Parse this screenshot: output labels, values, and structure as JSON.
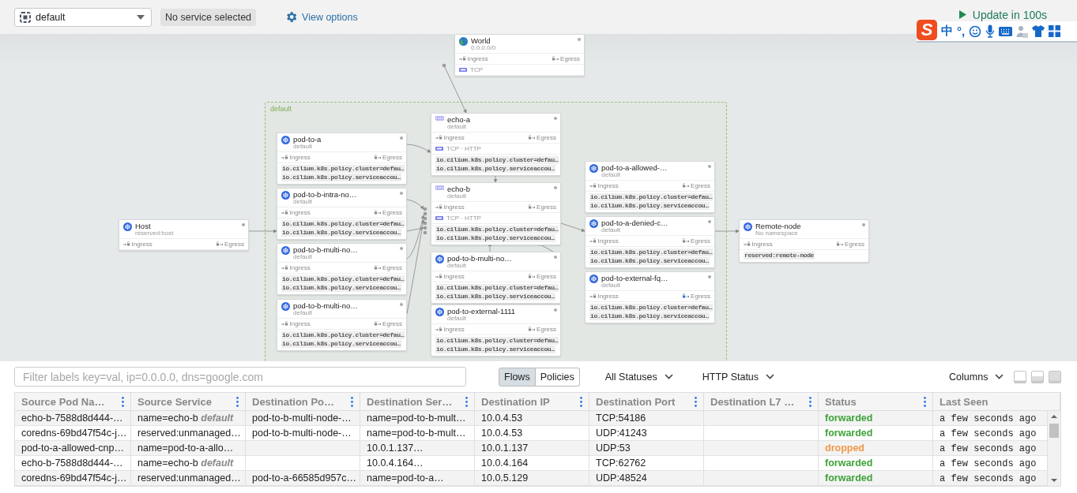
{
  "top_bar": {
    "namespace_select": {
      "value": "default"
    },
    "service_chip": "No service selected",
    "view_options": "View options",
    "update": "Update in 100s"
  },
  "ime_toolbar": {
    "logo": "S",
    "mode": "中",
    "punctuation": "°,"
  },
  "canvas": {
    "namespace": "default",
    "nodes": [
      {
        "kind": "world",
        "title": "World",
        "subtitle": "0.0.0.0/0",
        "ingress": "Ingress",
        "egress": "Egress",
        "egress_locked": false,
        "protocol": "TCP"
      },
      {
        "kind": "pod",
        "title": "pod-to-a",
        "subtitle": "default",
        "ingress": "Ingress",
        "egress": "Egress",
        "egress_locked": false,
        "labels": [
          "io.cilium.k8s.policy.cluster=defau…",
          "io.cilium.k8s.policy.serviceaccou…"
        ]
      },
      {
        "kind": "service",
        "title": "echo-a",
        "subtitle": "default",
        "ingress": "Ingress",
        "egress": "Egress",
        "egress_locked": false,
        "protocol": "TCP · HTTP",
        "labels": [
          "io.cilium.k8s.policy.cluster=defau…",
          "io.cilium.k8s.policy.serviceaccou…"
        ]
      },
      {
        "kind": "pod",
        "title": "pod-to-a-allowed-…",
        "subtitle": "default",
        "ingress": "Ingress",
        "egress": "Egress",
        "egress_locked": false,
        "labels": [
          "io.cilium.k8s.policy.cluster=defau…",
          "io.cilium.k8s.policy.serviceaccou…"
        ]
      },
      {
        "kind": "pod",
        "title": "pod-to-b-intra-no…",
        "subtitle": "default",
        "ingress": "Ingress",
        "egress": "Egress",
        "egress_locked": false,
        "labels": [
          "io.cilium.k8s.policy.cluster=defau…",
          "io.cilium.k8s.policy.serviceaccou…"
        ]
      },
      {
        "kind": "service",
        "title": "echo-b",
        "subtitle": "default",
        "ingress": "Ingress",
        "egress": "Egress",
        "egress_locked": false,
        "protocol": "TCP · HTTP",
        "labels": [
          "io.cilium.k8s.policy.cluster=defau…",
          "io.cilium.k8s.policy.serviceaccou…"
        ]
      },
      {
        "kind": "pod",
        "title": "Host",
        "subtitle": "reserved:host",
        "ingress": "Ingress",
        "egress": "Egress",
        "egress_locked": false
      },
      {
        "kind": "pod",
        "title": "pod-to-a-denied-c…",
        "subtitle": "default",
        "ingress": "Ingress",
        "egress": "Egress",
        "egress_locked": false,
        "labels": [
          "io.cilium.k8s.policy.cluster=defau…",
          "io.cilium.k8s.policy.serviceaccou…"
        ]
      },
      {
        "kind": "pod",
        "title": "Remote-node",
        "subtitle": "No namespace",
        "ingress": "Ingress",
        "egress": "Egress",
        "egress_locked": false,
        "labels": [
          "reserved:remote-node"
        ]
      },
      {
        "kind": "pod",
        "title": "pod-to-b-multi-no…",
        "subtitle": "default",
        "ingress": "Ingress",
        "egress": "Egress",
        "egress_locked": false,
        "labels": [
          "io.cilium.k8s.policy.cluster=defau…",
          "io.cilium.k8s.policy.serviceaccou…"
        ]
      },
      {
        "kind": "pod",
        "title": "pod-to-b-multi-no…",
        "subtitle": "default",
        "ingress": "Ingress",
        "egress": "Egress",
        "egress_locked": false,
        "labels": [
          "io.cilium.k8s.policy.cluster=defau…",
          "io.cilium.k8s.policy.serviceaccou…"
        ]
      },
      {
        "kind": "pod",
        "title": "pod-to-external-fq…",
        "subtitle": "default",
        "ingress": "Ingress",
        "egress": "Egress",
        "egress_locked": true,
        "labels": [
          "io.cilium.k8s.policy.cluster=defau…",
          "io.cilium.k8s.policy.serviceaccou…"
        ]
      },
      {
        "kind": "pod",
        "title": "pod-to-b-multi-no…",
        "subtitle": "default",
        "ingress": "Ingress",
        "egress": "Egress",
        "egress_locked": false,
        "labels": [
          "io.cilium.k8s.policy.cluster=defau…",
          "io.cilium.k8s.policy.serviceaccou…"
        ]
      },
      {
        "kind": "pod",
        "title": "pod-to-external-1111",
        "subtitle": "default",
        "ingress": "Ingress",
        "egress": "Egress",
        "egress_locked": false,
        "labels": [
          "io.cilium.k8s.policy.cluster=defau…",
          "io.cilium.k8s.policy.serviceaccou…"
        ]
      }
    ]
  },
  "flows_panel": {
    "filter": {
      "placeholder": "Filter labels key=val, ip=0.0.0.0, dns=google.com"
    },
    "view_tabs": [
      {
        "label": "Flows",
        "selected": true
      },
      {
        "label": "Policies",
        "selected": false
      }
    ],
    "dropdowns": [
      "All Statuses",
      "HTTP Status",
      "Columns"
    ],
    "table": {
      "columns": [
        "Source Pod Na…",
        "Source Service",
        "Destination Po…",
        "Destination Ser…",
        "Destination IP",
        "Destination Port",
        "Destination L7 …",
        "Status",
        "Last Seen"
      ],
      "rows": [
        {
          "source_pod": "echo-b-7588d8d444-…",
          "source_service": "name=echo-b *default*",
          "destination_pod": "pod-to-b-multi-node-…",
          "destination_service": "name=pod-to-b-mult…",
          "destination_ip": "10.0.4.53",
          "destination_port": "TCP:54186",
          "status": {
            "text": "forwarded",
            "kind": "forwarded"
          },
          "last_seen": "a few seconds ago"
        },
        {
          "source_pod": "coredns-69bd47f54c-j…",
          "source_service": "reserved:unmanaged…",
          "destination_pod": "pod-to-b-multi-node-…",
          "destination_service": "name=pod-to-b-mult…",
          "destination_ip": "10.0.4.53",
          "destination_port": "UDP:41243",
          "status": {
            "text": "forwarded",
            "kind": "forwarded"
          },
          "last_seen": "a few seconds ago"
        },
        {
          "source_pod": "pod-to-a-allowed-cnp…",
          "source_service": "name=pod-to-a-allo…",
          "destination_service": "10.0.1.137…",
          "destination_ip": "10.0.1.137",
          "destination_port": "UDP:53",
          "status": {
            "text": "dropped",
            "kind": "dropped"
          },
          "last_seen": "a few seconds ago"
        },
        {
          "source_pod": "echo-b-7588d8d444-…",
          "source_service": "name=echo-b *default*",
          "destination_service": "10.0.4.164…",
          "destination_ip": "10.0.4.164",
          "destination_port": "TCP:62762",
          "status": {
            "text": "forwarded",
            "kind": "forwarded"
          },
          "last_seen": "a few seconds ago"
        },
        {
          "source_pod": "coredns-69bd47f54c-j…",
          "source_service": "reserved:unmanaged…",
          "destination_pod": "pod-to-a-66585d957c…",
          "destination_service": "name=pod-to-a…",
          "destination_ip": "10.0.5.129",
          "destination_port": "UDP:48524",
          "status": {
            "text": "forwarded",
            "kind": "forwarded"
          },
          "last_seen": "a few seconds ago"
        }
      ]
    }
  }
}
